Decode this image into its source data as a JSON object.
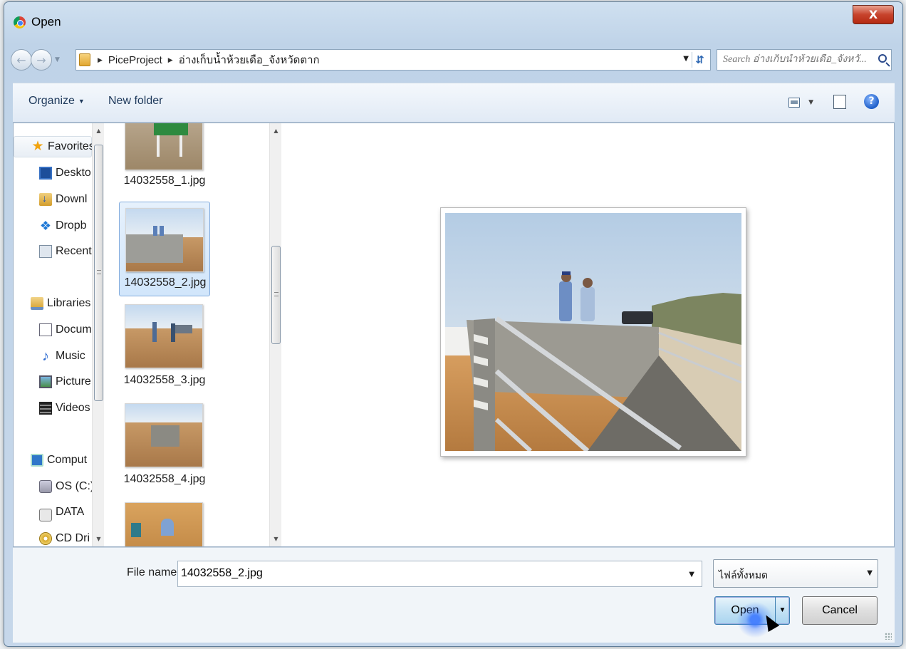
{
  "window": {
    "title": "Open",
    "close_label": "X"
  },
  "address": {
    "crumbs": [
      "PiceProject",
      "อ่างเก็บน้ำห้วยเดือ_จังหวัดตาก"
    ],
    "search_placeholder": "Search อ่างเก็บน้ำห้วยเดือ_จังหวั..."
  },
  "toolbar": {
    "organize_label": "Organize",
    "new_folder_label": "New folder"
  },
  "nav_pane": {
    "favorites_label": "Favorites",
    "favorites": [
      "Deskto",
      "Downl",
      "Dropb",
      "Recent"
    ],
    "libraries_label": "Libraries",
    "libraries": [
      "Docum",
      "Music",
      "Picture",
      "Videos"
    ],
    "computer_label": "Comput",
    "drives": [
      "OS (C:)",
      "DATA",
      "CD Dri"
    ]
  },
  "files": [
    {
      "name": "14032558_1.jpg",
      "selected": false
    },
    {
      "name": "14032558_2.jpg",
      "selected": true
    },
    {
      "name": "14032558_3.jpg",
      "selected": false
    },
    {
      "name": "14032558_4.jpg",
      "selected": false
    }
  ],
  "bottom": {
    "file_name_label": "File name:",
    "file_name_value": "14032558_2.jpg",
    "file_type_value": "ไฟล์ทั้งหมด",
    "open_label": "Open",
    "cancel_label": "Cancel"
  },
  "colors": {
    "frame": "#bfd3e8",
    "close": "#c7432c",
    "selection": "#d1e6fb",
    "open_button": "#a9d4ef"
  }
}
